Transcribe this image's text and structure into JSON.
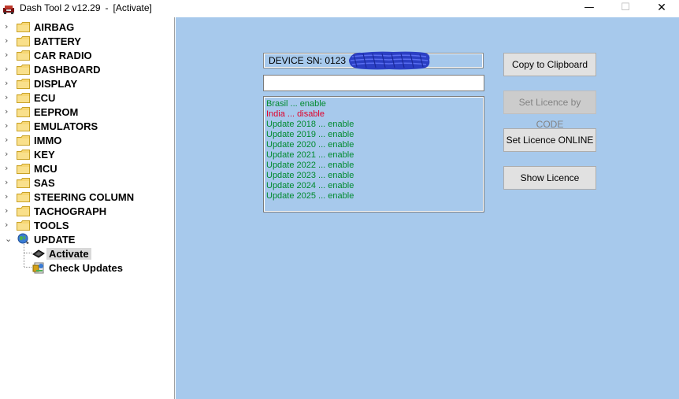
{
  "window": {
    "app_name": "Dash Tool 2 v12.29",
    "separator": "-",
    "context": "[Activate]",
    "controls": {
      "minimize": "—",
      "maximize": "☐",
      "close": "✕"
    }
  },
  "tree": {
    "items": [
      {
        "label": "AIRBAG",
        "icon": "folder-icon"
      },
      {
        "label": "BATTERY",
        "icon": "folder-icon"
      },
      {
        "label": "CAR RADIO",
        "icon": "folder-icon"
      },
      {
        "label": "DASHBOARD",
        "icon": "folder-icon"
      },
      {
        "label": "DISPLAY",
        "icon": "folder-icon"
      },
      {
        "label": "ECU",
        "icon": "folder-icon"
      },
      {
        "label": "EEPROM",
        "icon": "folder-icon"
      },
      {
        "label": "EMULATORS",
        "icon": "folder-icon"
      },
      {
        "label": "IMMO",
        "icon": "folder-icon"
      },
      {
        "label": "KEY",
        "icon": "folder-icon"
      },
      {
        "label": "MCU",
        "icon": "folder-icon"
      },
      {
        "label": "SAS",
        "icon": "folder-icon"
      },
      {
        "label": "STEERING COLUMN",
        "icon": "folder-icon"
      },
      {
        "label": "TACHOGRAPH",
        "icon": "folder-icon"
      },
      {
        "label": "TOOLS",
        "icon": "folder-icon"
      },
      {
        "label": "UPDATE",
        "icon": "globe-icon",
        "expanded": true
      }
    ],
    "children": [
      {
        "label": "Activate",
        "icon": "chip-icon",
        "selected": true
      },
      {
        "label": "Check Updates",
        "icon": "update-icon"
      }
    ]
  },
  "main": {
    "device_sn_label": "DEVICE SN: 0123",
    "input_value": "",
    "log": [
      {
        "text": "Brasil ... enable",
        "status": "enable"
      },
      {
        "text": "India ... disable",
        "status": "disable"
      },
      {
        "text": "Update 2018 ... enable",
        "status": "enable"
      },
      {
        "text": "Update 2019 ... enable",
        "status": "enable"
      },
      {
        "text": "Update 2020 ... enable",
        "status": "enable"
      },
      {
        "text": "Update 2021 ... enable",
        "status": "enable"
      },
      {
        "text": "Update 2022 ... enable",
        "status": "enable"
      },
      {
        "text": "Update 2023 ... enable",
        "status": "enable"
      },
      {
        "text": "Update 2024 ... enable",
        "status": "enable"
      },
      {
        "text": "Update 2025 ... enable",
        "status": "enable"
      }
    ],
    "buttons": {
      "copy": "Copy to Clipboard",
      "set_by_code": "Set Licence by CODE",
      "set_online": "Set Licence ONLINE",
      "show": "Show Licence"
    }
  },
  "colors": {
    "panel_bg": "#a7c9ec",
    "enable": "#008a2e",
    "disable": "#e0002a",
    "redaction": "#2b3fc4"
  }
}
